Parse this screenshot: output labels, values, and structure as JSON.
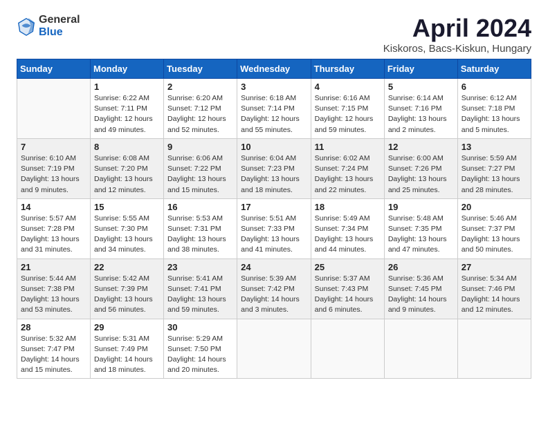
{
  "header": {
    "logo_general": "General",
    "logo_blue": "Blue",
    "month_title": "April 2024",
    "subtitle": "Kiskoros, Bacs-Kiskun, Hungary"
  },
  "weekdays": [
    "Sunday",
    "Monday",
    "Tuesday",
    "Wednesday",
    "Thursday",
    "Friday",
    "Saturday"
  ],
  "weeks": [
    [
      {
        "day": "",
        "sunrise": "",
        "sunset": "",
        "daylight": ""
      },
      {
        "day": "1",
        "sunrise": "Sunrise: 6:22 AM",
        "sunset": "Sunset: 7:11 PM",
        "daylight": "Daylight: 12 hours and 49 minutes."
      },
      {
        "day": "2",
        "sunrise": "Sunrise: 6:20 AM",
        "sunset": "Sunset: 7:12 PM",
        "daylight": "Daylight: 12 hours and 52 minutes."
      },
      {
        "day": "3",
        "sunrise": "Sunrise: 6:18 AM",
        "sunset": "Sunset: 7:14 PM",
        "daylight": "Daylight: 12 hours and 55 minutes."
      },
      {
        "day": "4",
        "sunrise": "Sunrise: 6:16 AM",
        "sunset": "Sunset: 7:15 PM",
        "daylight": "Daylight: 12 hours and 59 minutes."
      },
      {
        "day": "5",
        "sunrise": "Sunrise: 6:14 AM",
        "sunset": "Sunset: 7:16 PM",
        "daylight": "Daylight: 13 hours and 2 minutes."
      },
      {
        "day": "6",
        "sunrise": "Sunrise: 6:12 AM",
        "sunset": "Sunset: 7:18 PM",
        "daylight": "Daylight: 13 hours and 5 minutes."
      }
    ],
    [
      {
        "day": "7",
        "sunrise": "Sunrise: 6:10 AM",
        "sunset": "Sunset: 7:19 PM",
        "daylight": "Daylight: 13 hours and 9 minutes."
      },
      {
        "day": "8",
        "sunrise": "Sunrise: 6:08 AM",
        "sunset": "Sunset: 7:20 PM",
        "daylight": "Daylight: 13 hours and 12 minutes."
      },
      {
        "day": "9",
        "sunrise": "Sunrise: 6:06 AM",
        "sunset": "Sunset: 7:22 PM",
        "daylight": "Daylight: 13 hours and 15 minutes."
      },
      {
        "day": "10",
        "sunrise": "Sunrise: 6:04 AM",
        "sunset": "Sunset: 7:23 PM",
        "daylight": "Daylight: 13 hours and 18 minutes."
      },
      {
        "day": "11",
        "sunrise": "Sunrise: 6:02 AM",
        "sunset": "Sunset: 7:24 PM",
        "daylight": "Daylight: 13 hours and 22 minutes."
      },
      {
        "day": "12",
        "sunrise": "Sunrise: 6:00 AM",
        "sunset": "Sunset: 7:26 PM",
        "daylight": "Daylight: 13 hours and 25 minutes."
      },
      {
        "day": "13",
        "sunrise": "Sunrise: 5:59 AM",
        "sunset": "Sunset: 7:27 PM",
        "daylight": "Daylight: 13 hours and 28 minutes."
      }
    ],
    [
      {
        "day": "14",
        "sunrise": "Sunrise: 5:57 AM",
        "sunset": "Sunset: 7:28 PM",
        "daylight": "Daylight: 13 hours and 31 minutes."
      },
      {
        "day": "15",
        "sunrise": "Sunrise: 5:55 AM",
        "sunset": "Sunset: 7:30 PM",
        "daylight": "Daylight: 13 hours and 34 minutes."
      },
      {
        "day": "16",
        "sunrise": "Sunrise: 5:53 AM",
        "sunset": "Sunset: 7:31 PM",
        "daylight": "Daylight: 13 hours and 38 minutes."
      },
      {
        "day": "17",
        "sunrise": "Sunrise: 5:51 AM",
        "sunset": "Sunset: 7:33 PM",
        "daylight": "Daylight: 13 hours and 41 minutes."
      },
      {
        "day": "18",
        "sunrise": "Sunrise: 5:49 AM",
        "sunset": "Sunset: 7:34 PM",
        "daylight": "Daylight: 13 hours and 44 minutes."
      },
      {
        "day": "19",
        "sunrise": "Sunrise: 5:48 AM",
        "sunset": "Sunset: 7:35 PM",
        "daylight": "Daylight: 13 hours and 47 minutes."
      },
      {
        "day": "20",
        "sunrise": "Sunrise: 5:46 AM",
        "sunset": "Sunset: 7:37 PM",
        "daylight": "Daylight: 13 hours and 50 minutes."
      }
    ],
    [
      {
        "day": "21",
        "sunrise": "Sunrise: 5:44 AM",
        "sunset": "Sunset: 7:38 PM",
        "daylight": "Daylight: 13 hours and 53 minutes."
      },
      {
        "day": "22",
        "sunrise": "Sunrise: 5:42 AM",
        "sunset": "Sunset: 7:39 PM",
        "daylight": "Daylight: 13 hours and 56 minutes."
      },
      {
        "day": "23",
        "sunrise": "Sunrise: 5:41 AM",
        "sunset": "Sunset: 7:41 PM",
        "daylight": "Daylight: 13 hours and 59 minutes."
      },
      {
        "day": "24",
        "sunrise": "Sunrise: 5:39 AM",
        "sunset": "Sunset: 7:42 PM",
        "daylight": "Daylight: 14 hours and 3 minutes."
      },
      {
        "day": "25",
        "sunrise": "Sunrise: 5:37 AM",
        "sunset": "Sunset: 7:43 PM",
        "daylight": "Daylight: 14 hours and 6 minutes."
      },
      {
        "day": "26",
        "sunrise": "Sunrise: 5:36 AM",
        "sunset": "Sunset: 7:45 PM",
        "daylight": "Daylight: 14 hours and 9 minutes."
      },
      {
        "day": "27",
        "sunrise": "Sunrise: 5:34 AM",
        "sunset": "Sunset: 7:46 PM",
        "daylight": "Daylight: 14 hours and 12 minutes."
      }
    ],
    [
      {
        "day": "28",
        "sunrise": "Sunrise: 5:32 AM",
        "sunset": "Sunset: 7:47 PM",
        "daylight": "Daylight: 14 hours and 15 minutes."
      },
      {
        "day": "29",
        "sunrise": "Sunrise: 5:31 AM",
        "sunset": "Sunset: 7:49 PM",
        "daylight": "Daylight: 14 hours and 18 minutes."
      },
      {
        "day": "30",
        "sunrise": "Sunrise: 5:29 AM",
        "sunset": "Sunset: 7:50 PM",
        "daylight": "Daylight: 14 hours and 20 minutes."
      },
      {
        "day": "",
        "sunrise": "",
        "sunset": "",
        "daylight": ""
      },
      {
        "day": "",
        "sunrise": "",
        "sunset": "",
        "daylight": ""
      },
      {
        "day": "",
        "sunrise": "",
        "sunset": "",
        "daylight": ""
      },
      {
        "day": "",
        "sunrise": "",
        "sunset": "",
        "daylight": ""
      }
    ]
  ]
}
